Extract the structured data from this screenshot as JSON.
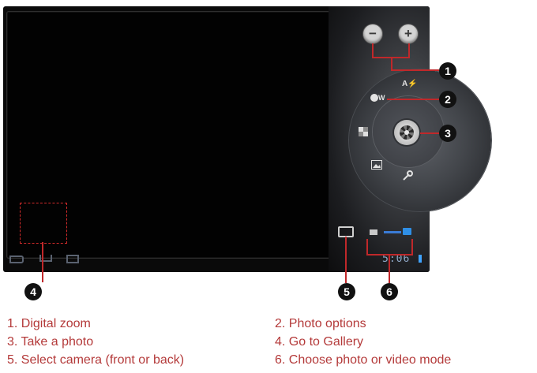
{
  "camera": {
    "zoom_out_symbol": "−",
    "zoom_in_symbol": "+",
    "icons": {
      "zoom_out": "minus-circle-icon",
      "zoom_in": "plus-circle-icon",
      "shutter": "aperture-icon",
      "flash": "flash-auto-icon",
      "white_balance": "white-balance-icon",
      "scene": "scene-mode-icon",
      "picture_size": "picture-size-icon",
      "settings": "wrench-icon",
      "camera_switch": "camera-switch-icon",
      "video_mode": "video-camera-icon",
      "photo_mode": "camera-icon"
    },
    "wb_label": "W",
    "flash_label": "A"
  },
  "status_bar": {
    "clock": "5:06",
    "nav_icons": [
      "back-icon",
      "home-icon",
      "recent-apps-icon"
    ]
  },
  "badges": [
    "1",
    "2",
    "3",
    "4",
    "5",
    "6"
  ],
  "legend": {
    "item1": "1. Digital zoom",
    "item2": "2. Photo options",
    "item3": "3. Take a photo",
    "item4": "4. Go to Gallery",
    "item5": "5. Select camera (front or back)",
    "item6": "6. Choose photo or video mode"
  },
  "colors": {
    "callout": "#c0282a",
    "legend_text": "#b43a3a",
    "badge_bg": "#111111"
  }
}
